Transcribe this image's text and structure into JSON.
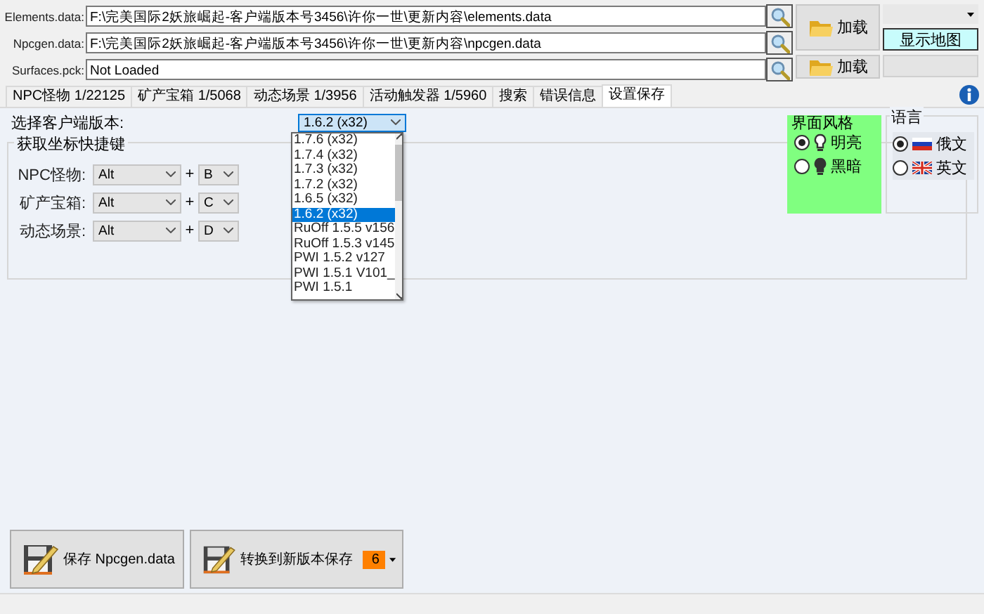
{
  "files": [
    {
      "label": "Elements.data:",
      "value": "F:\\完美国际2妖旅崛起-客户端版本号3456\\许你一世\\更新内容\\elements.data"
    },
    {
      "label": "Npcgen.data:",
      "value": "F:\\完美国际2妖旅崛起-客户端版本号3456\\许你一世\\更新内容\\npcgen.data"
    },
    {
      "label": "Surfaces.pck:",
      "value": "Not Loaded"
    }
  ],
  "load_buttons": [
    "加载",
    "加载"
  ],
  "show_map_button": "显示地图",
  "tabs": [
    {
      "label": "NPC怪物 1/22125",
      "selected": false
    },
    {
      "label": "矿产宝箱 1/5068",
      "selected": false
    },
    {
      "label": "动态场景 1/3956",
      "selected": false
    },
    {
      "label": "活动触发器 1/5960",
      "selected": false
    },
    {
      "label": "搜索",
      "selected": false
    },
    {
      "label": "错误信息",
      "selected": false
    },
    {
      "label": "设置保存",
      "selected": true
    }
  ],
  "version": {
    "label": "选择客户端版本:",
    "value": "1.6.2 (x32)",
    "expanded": true,
    "options": [
      {
        "label": "1.7.6 (x32)",
        "selected": false
      },
      {
        "label": "1.7.4 (x32)",
        "selected": false
      },
      {
        "label": "1.7.3 (x32)",
        "selected": false
      },
      {
        "label": "1.7.2 (x32)",
        "selected": false
      },
      {
        "label": "1.6.5 (x32)",
        "selected": false
      },
      {
        "label": "1.6.2 (x32)",
        "selected": true
      },
      {
        "label": "RuOff 1.5.5 v156",
        "selected": false
      },
      {
        "label": "RuOff 1.5.3 v145",
        "selected": false
      },
      {
        "label": "PWI 1.5.2 v127",
        "selected": false
      },
      {
        "label": "PWI 1.5.1 V101_",
        "selected": false
      },
      {
        "label": "PWI 1.5.1",
        "selected": false
      }
    ]
  },
  "hotkeys": {
    "title": "获取坐标快捷键",
    "rows": [
      {
        "label": "NPC怪物:",
        "modifier": "Alt",
        "plus": "+",
        "key": "B"
      },
      {
        "label": "矿产宝箱:",
        "modifier": "Alt",
        "plus": "+",
        "key": "C"
      },
      {
        "label": "动态场景:",
        "modifier": "Alt",
        "plus": "+",
        "key": "D"
      }
    ]
  },
  "theme": {
    "title": "界面风格",
    "options": [
      {
        "label": "明亮",
        "kind": "light",
        "selected": true
      },
      {
        "label": "黑暗",
        "kind": "dark",
        "selected": false
      }
    ]
  },
  "language": {
    "title": "语言",
    "options": [
      {
        "label": "俄文",
        "kind": "ru",
        "selected": true
      },
      {
        "label": "英文",
        "kind": "en",
        "selected": false
      }
    ]
  },
  "actions": [
    {
      "label": "保存 Npcgen.data",
      "kind": "save"
    },
    {
      "label": "转换到新版本保存",
      "kind": "convert",
      "value": "6"
    }
  ]
}
